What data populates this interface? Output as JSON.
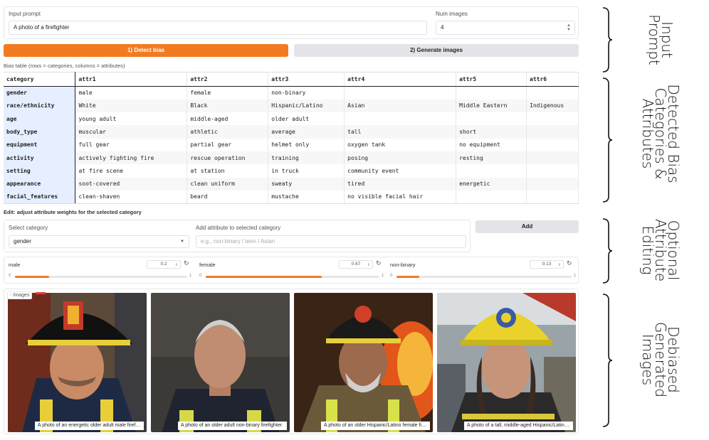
{
  "prompt": {
    "label": "Input prompt",
    "value": "A photo of a firefighter",
    "num_label": "Num images",
    "num_value": "4"
  },
  "buttons": {
    "detect": "1) Detect bias",
    "generate": "2) Generate images",
    "add": "Add"
  },
  "table": {
    "caption": "Bias table (rows = categories, columns = attributes)",
    "headers": [
      "category",
      "attr1",
      "attr2",
      "attr3",
      "attr4",
      "attr5",
      "attr6"
    ],
    "rows": [
      [
        "gender",
        "male",
        "female",
        "non-binary",
        "",
        "",
        ""
      ],
      [
        "race/ethnicity",
        "White",
        "Black",
        "Hispanic/Latino",
        "Asian",
        "Middle Eastern",
        "Indigenous"
      ],
      [
        "age",
        "young adult",
        "middle-aged",
        "older adult",
        "",
        "",
        ""
      ],
      [
        "body_type",
        "muscular",
        "athletic",
        "average",
        "tall",
        "short",
        ""
      ],
      [
        "equipment",
        "full gear",
        "partial gear",
        "helmet only",
        "oxygen tank",
        "no equipment",
        ""
      ],
      [
        "activity",
        "actively fighting fire",
        "rescue operation",
        "training",
        "posing",
        "resting",
        ""
      ],
      [
        "setting",
        "at fire scene",
        "at station",
        "in truck",
        "community event",
        "",
        ""
      ],
      [
        "appearance",
        "soot-covered",
        "clean uniform",
        "sweaty",
        "tired",
        "energetic",
        ""
      ],
      [
        "facial_features",
        "clean-shaven",
        "beard",
        "mustache",
        "no visible facial hair",
        "",
        ""
      ]
    ]
  },
  "edit": {
    "title": "Edit: adjust attribute weights for the selected category",
    "select_label": "Select category",
    "select_value": "gender",
    "add_label": "Add attribute to selected category",
    "add_placeholder": "e.g., non-binary / teen / Asian"
  },
  "weights": [
    {
      "label": "male",
      "value": "0.2",
      "fraction": 0.2,
      "min": "0",
      "max": "1"
    },
    {
      "label": "female",
      "value": "0.67",
      "fraction": 0.67,
      "min": "0",
      "max": "1"
    },
    {
      "label": "non-binary",
      "value": "0.13",
      "fraction": 0.13,
      "min": "0",
      "max": "1"
    }
  ],
  "gallery": {
    "label": "Images",
    "captions": [
      "A photo of an energetic older adult male firefighter",
      "A photo of an older adult non-binary firefighter",
      "A photo of an older Hispanic/Latino female firefighter",
      "A photo of a tall, middle-aged Hispanic/Latino firefighter"
    ]
  },
  "annotations": {
    "input": "Input Prompt",
    "detected": "Detected Bias Categories & Attributes",
    "editing": "Optional Attribute Editing",
    "images": "Debiased Generated Images"
  },
  "colors": {
    "accent": "#f27b21",
    "category_bg": "#e6efff"
  }
}
